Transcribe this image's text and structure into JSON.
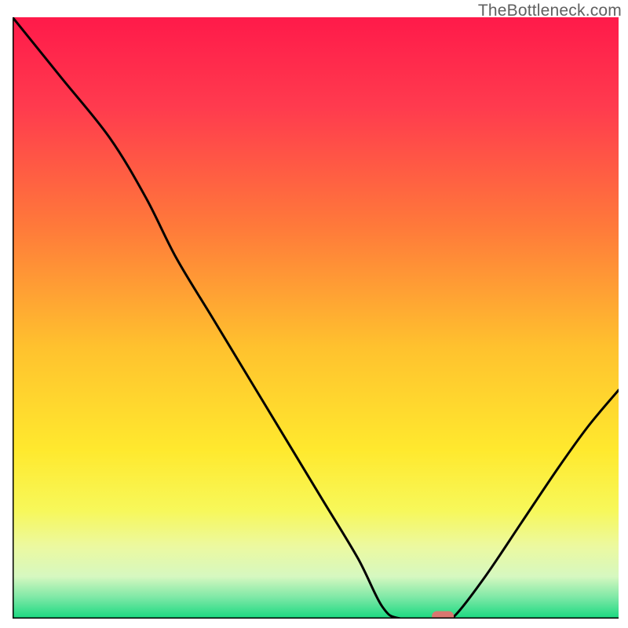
{
  "watermark": "TheBottleneck.com",
  "chart_data": {
    "type": "line",
    "title": "",
    "xlabel": "",
    "ylabel": "",
    "xlim": [
      0,
      100
    ],
    "ylim": [
      0,
      100
    ],
    "grid": false,
    "curve": [
      {
        "x": 0,
        "y": 100
      },
      {
        "x": 8,
        "y": 90
      },
      {
        "x": 16,
        "y": 80
      },
      {
        "x": 22,
        "y": 70
      },
      {
        "x": 27,
        "y": 60
      },
      {
        "x": 33,
        "y": 50
      },
      {
        "x": 39,
        "y": 40
      },
      {
        "x": 45,
        "y": 30
      },
      {
        "x": 51,
        "y": 20
      },
      {
        "x": 57,
        "y": 10
      },
      {
        "x": 61,
        "y": 2
      },
      {
        "x": 64,
        "y": 0
      },
      {
        "x": 71,
        "y": 0
      },
      {
        "x": 73,
        "y": 0.5
      },
      {
        "x": 78,
        "y": 7
      },
      {
        "x": 84,
        "y": 16
      },
      {
        "x": 90,
        "y": 25
      },
      {
        "x": 95,
        "y": 32
      },
      {
        "x": 100,
        "y": 38
      }
    ],
    "marker": {
      "x": 71,
      "y": 0,
      "color": "#d97770"
    },
    "gradient_stops": [
      {
        "offset": 0.0,
        "color": "#ff1a4a"
      },
      {
        "offset": 0.15,
        "color": "#ff3b4e"
      },
      {
        "offset": 0.35,
        "color": "#ff7a3a"
      },
      {
        "offset": 0.55,
        "color": "#ffc22e"
      },
      {
        "offset": 0.72,
        "color": "#ffe92e"
      },
      {
        "offset": 0.82,
        "color": "#f7f85a"
      },
      {
        "offset": 0.88,
        "color": "#ecf9a0"
      },
      {
        "offset": 0.93,
        "color": "#d6f8c0"
      },
      {
        "offset": 0.965,
        "color": "#7de8a6"
      },
      {
        "offset": 1.0,
        "color": "#18d980"
      }
    ]
  }
}
